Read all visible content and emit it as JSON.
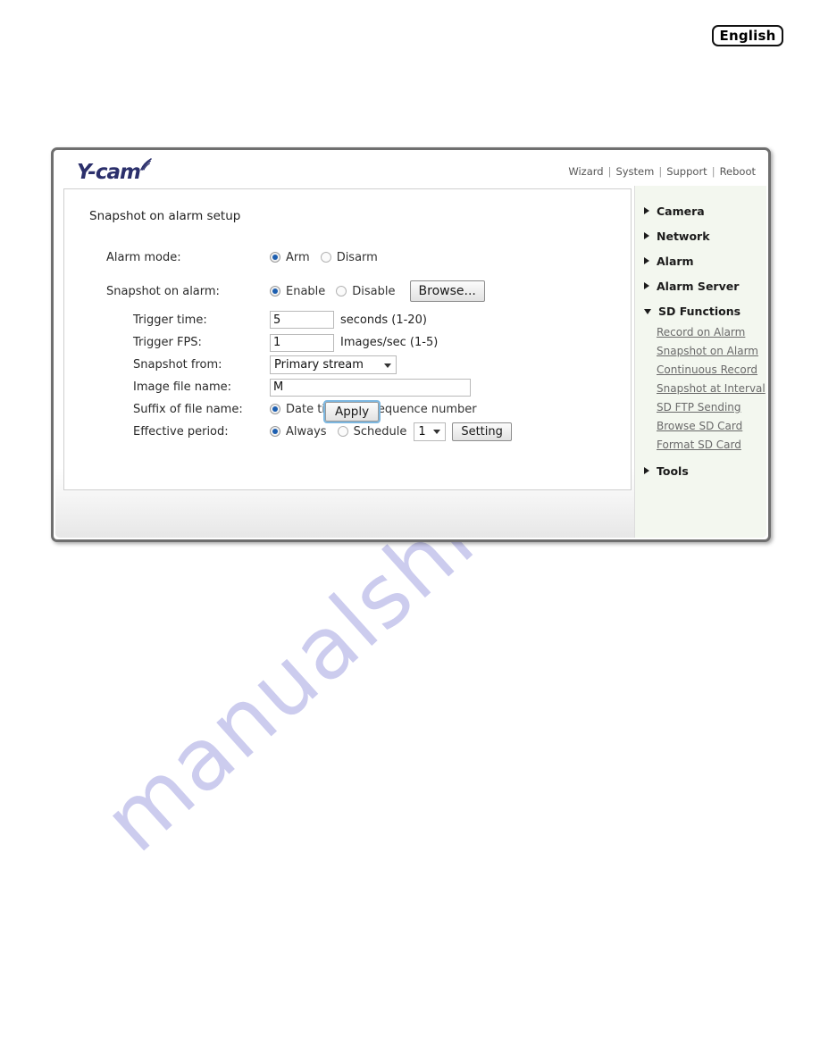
{
  "language_button": {
    "label": "English"
  },
  "watermark": {
    "text": "manualshive.com"
  },
  "header": {
    "logo_text": "Y-cam",
    "nav": [
      {
        "label": "Wizard"
      },
      {
        "label": "System"
      },
      {
        "label": "Support"
      },
      {
        "label": "Reboot"
      }
    ],
    "separator": "|"
  },
  "main": {
    "section_title": "Snapshot on alarm setup",
    "rows": {
      "alarm_mode": {
        "label": "Alarm mode:",
        "options": [
          {
            "label": "Arm",
            "selected": true
          },
          {
            "label": "Disarm",
            "selected": false
          }
        ]
      },
      "snapshot_on_alarm": {
        "label": "Snapshot on alarm:",
        "options": [
          {
            "label": "Enable",
            "selected": true
          },
          {
            "label": "Disable",
            "selected": false
          }
        ],
        "browse_button": "Browse..."
      },
      "trigger_time": {
        "label": "Trigger time:",
        "value": "5",
        "unit": "seconds (1-20)"
      },
      "trigger_fps": {
        "label": "Trigger FPS:",
        "value": "1",
        "unit": "Images/sec (1-5)"
      },
      "snapshot_from": {
        "label": "Snapshot from:",
        "selected": "Primary stream"
      },
      "image_file_name": {
        "label": "Image file name:",
        "value": "M"
      },
      "suffix_of_file_name": {
        "label": "Suffix of file name:",
        "options": [
          {
            "label": "Date time",
            "selected": true
          },
          {
            "label": "Sequence number",
            "selected": false
          }
        ]
      },
      "effective_period": {
        "label": "Effective period:",
        "options": [
          {
            "label": "Always",
            "selected": true
          },
          {
            "label": "Schedule",
            "selected": false
          }
        ],
        "schedule_number": "1",
        "setting_button": "Setting"
      }
    },
    "apply_button": "Apply"
  },
  "sidebar": {
    "groups": [
      {
        "label": "Camera",
        "expanded": false
      },
      {
        "label": "Network",
        "expanded": false
      },
      {
        "label": "Alarm",
        "expanded": false
      },
      {
        "label": "Alarm Server",
        "expanded": false
      },
      {
        "label": "SD Functions",
        "expanded": true
      }
    ],
    "sd_items": [
      {
        "label": "Record on Alarm"
      },
      {
        "label": "Snapshot on Alarm"
      },
      {
        "label": "Continuous Record"
      },
      {
        "label": "Snapshot at Interval"
      },
      {
        "label": "SD FTP Sending"
      },
      {
        "label": "Browse SD Card"
      },
      {
        "label": "Format SD Card"
      }
    ],
    "tools": {
      "label": "Tools",
      "expanded": false
    }
  },
  "colors": {
    "accent_radio": "#1d5fb0",
    "logo": "#2b2f6b",
    "sidebar_bg": "#f3f7ef",
    "watermark": "#b9b9e8",
    "focus_outline": "#7cb7e0"
  }
}
